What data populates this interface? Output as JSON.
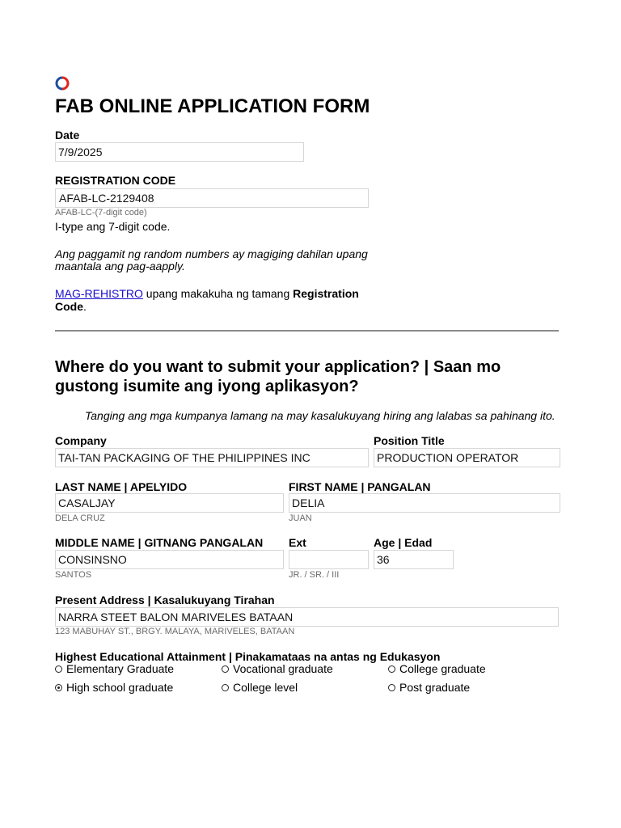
{
  "form": {
    "title": "FAB ONLINE APPLICATION FORM",
    "logo_colors": {
      "ring_a": "#e2231a",
      "ring_b": "#1f4e9c"
    }
  },
  "date": {
    "label": "Date",
    "value": "7/9/2025"
  },
  "registration": {
    "label": "REGISTRATION CODE",
    "value": "AFAB-LC-2129408",
    "hint": "AFAB-LC-(7-digit code)",
    "instruction": "I-type ang 7-digit code.",
    "warning_line1": "Ang paggamit ng random numbers ay magiging dahilan upang",
    "warning_line2": "maantala ang pag-aapply.",
    "register_link": "MAG-REHISTRO",
    "register_text": " upang makakuha ng tamang ",
    "register_bold1": "Registration",
    "register_bold2": "Code",
    "register_period": "."
  },
  "submit_section": {
    "heading_line1": "Where do you want to submit your application? | Saan mo",
    "heading_line2": "gustong isumite ang iyong aplikasyon?",
    "note": "Tanging ang mga kumpanya lamang na may kasalukuyang hiring ang lalabas sa pahinang ito."
  },
  "company": {
    "label": "Company",
    "value": "TAI-TAN PACKAGING OF THE PHILIPPINES INC"
  },
  "position": {
    "label": "Position Title",
    "value": "PRODUCTION OPERATOR"
  },
  "last_name": {
    "label": "LAST NAME | APELYIDO",
    "value": "CASALJAY",
    "hint": "DELA CRUZ"
  },
  "first_name": {
    "label": "FIRST NAME | PANGALAN",
    "value": "DELIA",
    "hint": "JUAN"
  },
  "middle_name": {
    "label": "MIDDLE NAME | GITNANG PANGALAN",
    "value": "CONSINSNO",
    "hint": "SANTOS"
  },
  "ext": {
    "label": "Ext",
    "value": "",
    "hint": "JR. / SR. / III"
  },
  "age": {
    "label": "Age | Edad",
    "value": "36"
  },
  "address": {
    "label": "Present Address | Kasalukuyang Tirahan",
    "value": "NARRA STEET BALON MARIVELES BATAAN",
    "hint": "123 MABUHAY ST., BRGY. MALAYA, MARIVELES, BATAAN"
  },
  "education": {
    "label": "Highest Educational Attainment | Pinakamataas na antas ng Edukasyon",
    "options": [
      {
        "label": "Elementary Graduate",
        "checked": false
      },
      {
        "label": "Vocational graduate",
        "checked": false
      },
      {
        "label": "College graduate",
        "checked": false
      },
      {
        "label": "High school graduate",
        "checked": true
      },
      {
        "label": "College level",
        "checked": false
      },
      {
        "label": "Post graduate",
        "checked": false
      }
    ]
  }
}
